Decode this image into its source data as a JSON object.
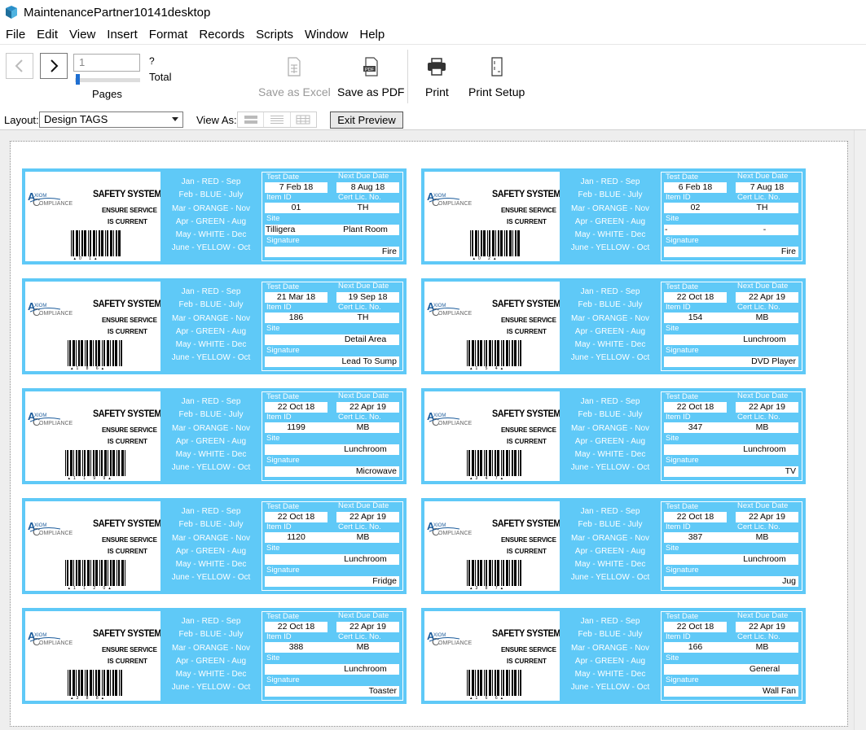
{
  "window": {
    "title": "MaintenancePartner10141desktop"
  },
  "menu": [
    "File",
    "Edit",
    "View",
    "Insert",
    "Format",
    "Records",
    "Scripts",
    "Window",
    "Help"
  ],
  "toolbar": {
    "page_input_value": "1",
    "page_count_unknown": "?",
    "total_label": "Total",
    "pages_label": "Pages",
    "save_excel_label": "Save as Excel",
    "save_pdf_label": "Save as PDF",
    "print_label": "Print",
    "print_setup_label": "Print Setup"
  },
  "layoutbar": {
    "layout_label": "Layout:",
    "layout_value": "Design TAGS",
    "view_as_label": "View As:",
    "exit_preview_label": "Exit Preview"
  },
  "tag_common": {
    "safety_system": "SAFETY SYSTEM",
    "ensure_service": "ENSURE SERVICE",
    "is_current": "IS CURRENT",
    "logo_text_axiom": "XIOM",
    "logo_text_compliance": "OMPLIANCE",
    "months": [
      "Jan - RED - Sep",
      "Feb - BLUE - July",
      "Mar - ORANGE - Nov",
      "Apr - GREEN - Aug",
      "May - WHITE - Dec",
      "June - YELLOW - Oct"
    ],
    "labels": {
      "test_date": "Test Date",
      "next_due": "Next Due Date",
      "item_id": "Item ID",
      "cert_lic": "Cert Lic. No.",
      "site": "Site",
      "signature": "Signature"
    },
    "colors": {
      "tag_bg": "#5fc9f7",
      "logo_blue": "#1a5a9a"
    }
  },
  "tags": [
    {
      "test_date": "7 Feb 18",
      "next_due": "8 Aug 18",
      "item_id": "01",
      "cert": "TH",
      "site_left": "Tilligera",
      "site_right": "Plant Room",
      "signature": "Fire",
      "barcode_text": "01"
    },
    {
      "test_date": "6 Feb 18",
      "next_due": "7 Aug 18",
      "item_id": "02",
      "cert": "TH",
      "site_left": "-",
      "site_right": "-",
      "signature": "Fire",
      "barcode_text": "02"
    },
    {
      "test_date": "21 Mar 18",
      "next_due": "19 Sep 18",
      "item_id": "186",
      "cert": "TH",
      "site_left": "",
      "site_right": "Detail Area",
      "signature": "Lead To Sump",
      "barcode_text": "186"
    },
    {
      "test_date": "22 Oct 18",
      "next_due": "22 Apr 19",
      "item_id": "154",
      "cert": "MB",
      "site_left": "",
      "site_right": "Lunchroom",
      "signature": "DVD Player",
      "barcode_text": "154"
    },
    {
      "test_date": "22 Oct 18",
      "next_due": "22 Apr 19",
      "item_id": "1199",
      "cert": "MB",
      "site_left": "",
      "site_right": "Lunchroom",
      "signature": "Microwave",
      "barcode_text": "1199"
    },
    {
      "test_date": "22 Oct 18",
      "next_due": "22 Apr 19",
      "item_id": "347",
      "cert": "MB",
      "site_left": "",
      "site_right": "Lunchroom",
      "signature": "TV",
      "barcode_text": "347"
    },
    {
      "test_date": "22 Oct 18",
      "next_due": "22 Apr 19",
      "item_id": "1120",
      "cert": "MB",
      "site_left": "",
      "site_right": "Lunchroom",
      "signature": "Fridge",
      "barcode_text": "1120"
    },
    {
      "test_date": "22 Oct 18",
      "next_due": "22 Apr 19",
      "item_id": "387",
      "cert": "MB",
      "site_left": "",
      "site_right": "Lunchroom",
      "signature": "Jug",
      "barcode_text": "387"
    },
    {
      "test_date": "22 Oct 18",
      "next_due": "22 Apr 19",
      "item_id": "388",
      "cert": "MB",
      "site_left": "",
      "site_right": "Lunchroom",
      "signature": "Toaster",
      "barcode_text": "388"
    },
    {
      "test_date": "22 Oct 18",
      "next_due": "22 Apr 19",
      "item_id": "166",
      "cert": "MB",
      "site_left": "",
      "site_right": "General",
      "signature": "Wall Fan",
      "barcode_text": "166"
    }
  ]
}
